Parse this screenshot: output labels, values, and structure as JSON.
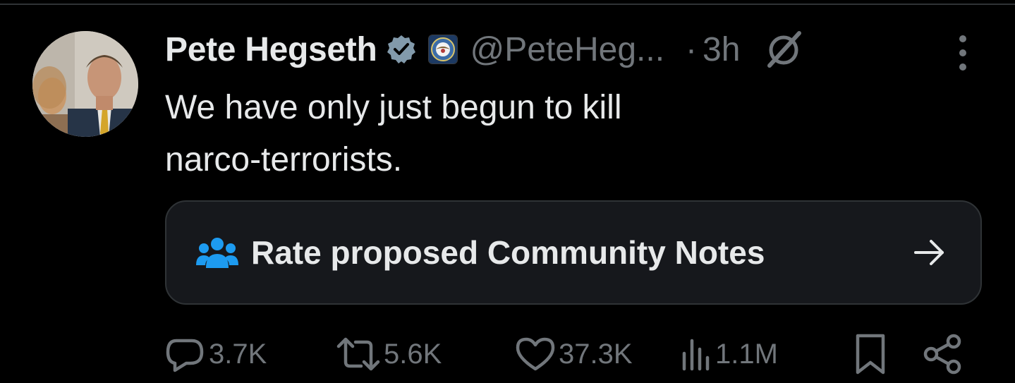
{
  "tweet": {
    "author_name": "Pete Hegseth",
    "handle": "@PeteHeg...",
    "separator": "·",
    "time": "3h",
    "text_line1": "We have only just begun to kill",
    "text_line2": "narco-terrorists."
  },
  "community_notes": {
    "label": "Rate proposed Community Notes",
    "arrow": "→"
  },
  "actions": {
    "replies": "3.7K",
    "reposts": "5.6K",
    "likes": "37.3K",
    "views": "1.1M"
  },
  "icons": {
    "verified": "verified-badge-icon",
    "affiliate": "government-seal-icon",
    "grok": "grok-icon",
    "more": "more-options-icon",
    "community": "community-notes-icon",
    "reply": "reply-icon",
    "repost": "repost-icon",
    "like": "heart-icon",
    "views": "views-chart-icon",
    "bookmark": "bookmark-icon",
    "share": "share-icon"
  },
  "colors": {
    "background": "#000000",
    "text": "#e7e9ea",
    "secondary_text": "#71767b",
    "card_background": "#16181c",
    "card_border": "#2f3336",
    "community_notes_blue": "#1d9bf0"
  }
}
